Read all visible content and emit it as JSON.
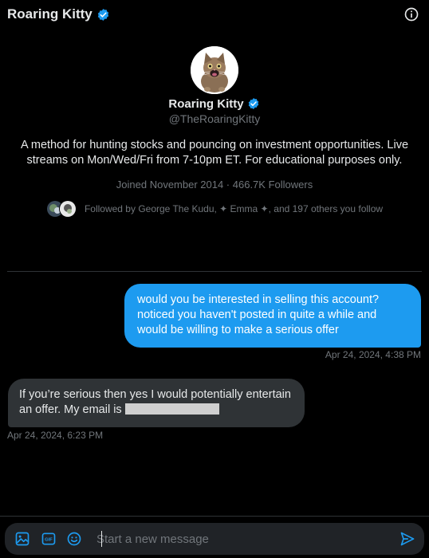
{
  "header": {
    "title": "Roaring Kitty",
    "info_icon": "info-circle-icon"
  },
  "profile": {
    "name": "Roaring Kitty",
    "handle": "@TheRoaringKitty",
    "bio": "A method for hunting stocks and pouncing on investment opportunities. Live streams on Mon/Wed/Fri from 7-10pm ET. For educational purposes only.",
    "meta": "Joined November 2014 · 466.7K Followers",
    "followed_by": "Followed by George The Kudu, ✦ Emma ✦, and 197 others you follow"
  },
  "messages": [
    {
      "direction": "outgoing",
      "text": "would you be interested in selling this account? noticed you haven't posted in quite a while and would be willing to make a serious offer",
      "time": "Apr 24, 2024, 4:38 PM"
    },
    {
      "direction": "incoming",
      "text": "If you’re serious then yes I would potentially entertain an offer. My email is",
      "time": "Apr 24, 2024, 6:23 PM"
    }
  ],
  "composer": {
    "placeholder": "Start a new message",
    "icons": [
      "image-icon",
      "gif-icon",
      "emoji-icon",
      "send-icon"
    ]
  },
  "colors": {
    "background": "#000000",
    "accent": "#1d9bf0",
    "incoming_bubble": "#2f3336",
    "muted_text": "#71767b",
    "verified": "#1d9bf0"
  }
}
